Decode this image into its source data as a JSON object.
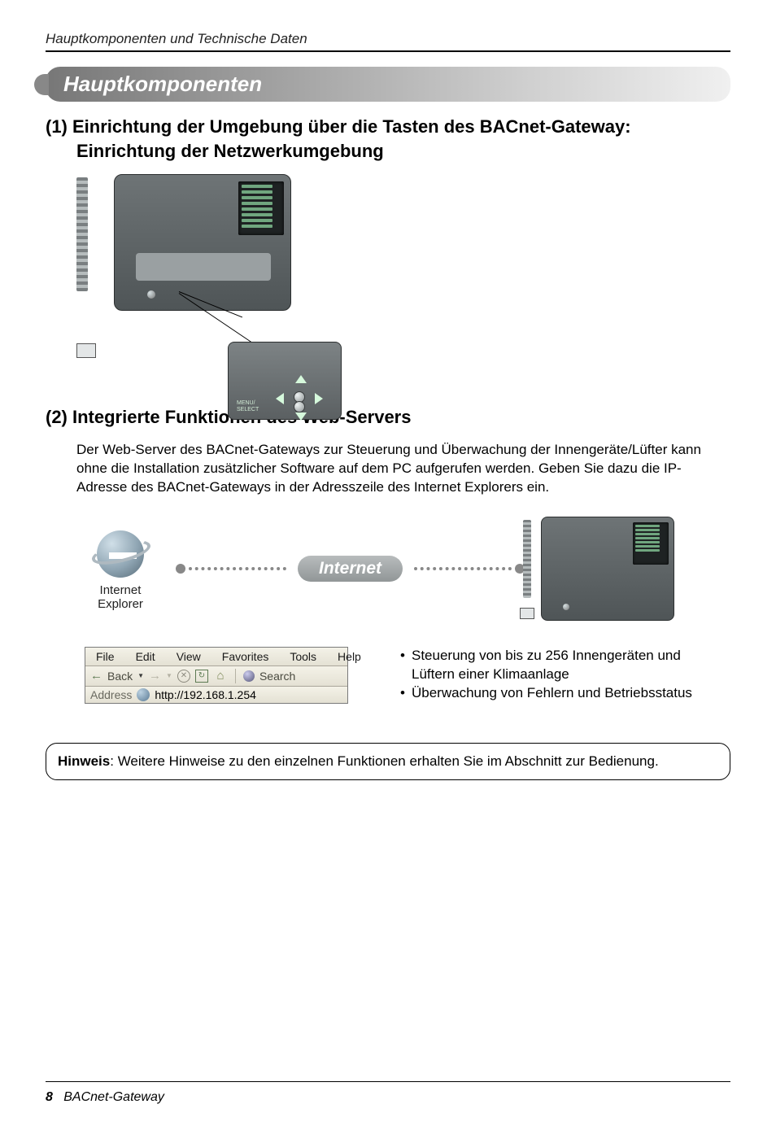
{
  "running_head": "Hauptkomponenten und Technische Daten",
  "section_title": "Hauptkomponenten",
  "h2_1_line1": "(1) Einrichtung der Umgebung über die Tasten des BACnet-Gateway:",
  "h2_1_line2": "Einrichtung der Netzwerkumgebung",
  "panel_label_line1": "MENU/",
  "panel_label_line2": "SELECT",
  "h2_2": "(2) Integrierte Funktionen des Web-Servers",
  "body_p": "Der Web-Server des BACnet-Gateways zur Steuerung und Überwachung der Innengeräte/Lüfter kann ohne die Installation zusätzlicher Software auf dem PC aufgerufen werden. Geben Sie dazu die IP-Adresse des BACnet-Gateways in der Adresszeile des Internet Explorers ein.",
  "ie_label_1": "Internet",
  "ie_label_2": "Explorer",
  "internet_pill": "Internet",
  "toolbar": {
    "menu": {
      "file": "File",
      "edit": "Edit",
      "view": "View",
      "favorites": "Favorites",
      "tools": "Tools",
      "help": "Help"
    },
    "back": "Back",
    "search": "Search",
    "address_label": "Address",
    "url": "http://192.168.1.254"
  },
  "bullets": {
    "b1_l1": "Steuerung von bis zu 256 Innengeräten und",
    "b1_l2": "Lüftern einer Klimaanlage",
    "b2": "Überwachung von Fehlern und Betriebsstatus"
  },
  "note_label": "Hinweis",
  "note_text": ": Weitere Hinweise zu den einzelnen Funktionen erhalten Sie im Abschnitt zur Bedienung.",
  "footer_page": "8",
  "footer_title": "BACnet-Gateway"
}
